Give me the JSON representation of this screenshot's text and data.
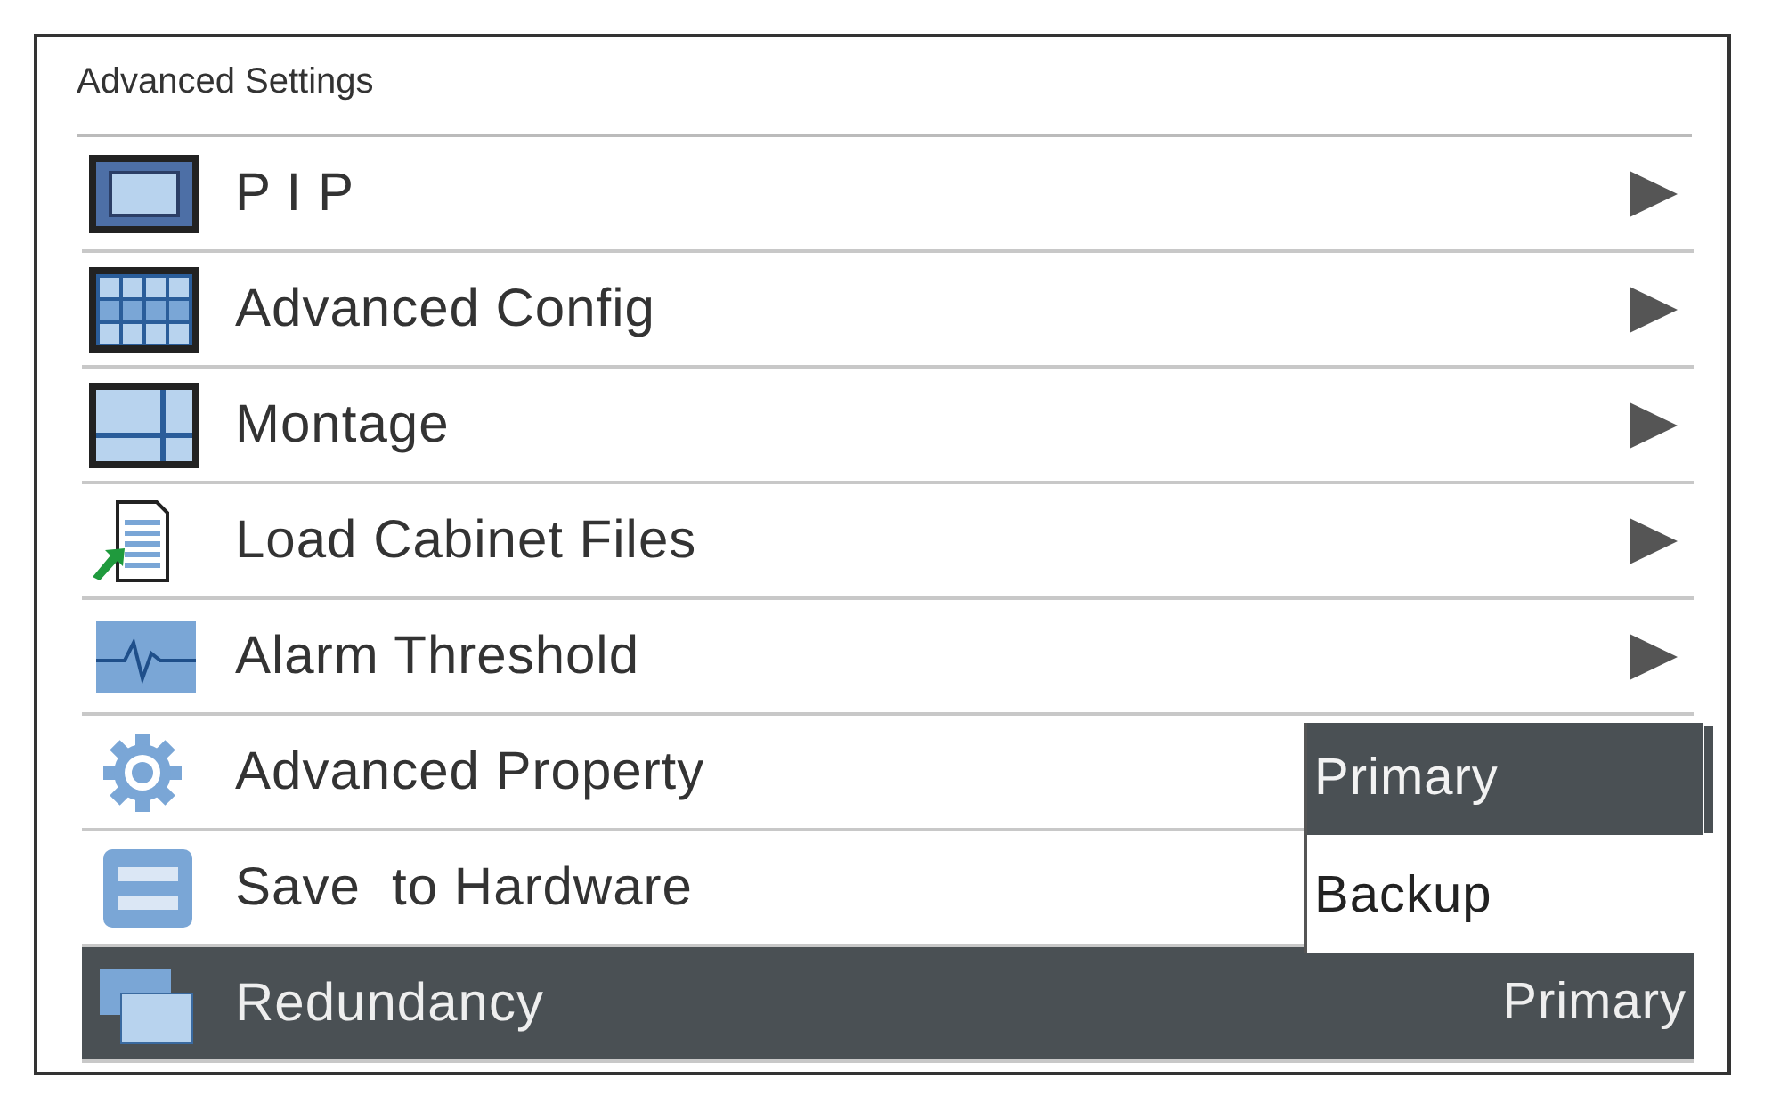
{
  "title": "Advanced Settings",
  "items": [
    {
      "label": "P I P",
      "kind": "window",
      "submenu": true,
      "selected": false
    },
    {
      "label": "Advanced Config",
      "kind": "grid",
      "submenu": true,
      "selected": false
    },
    {
      "label": "Montage",
      "kind": "split",
      "submenu": true,
      "selected": false
    },
    {
      "label": "Load Cabinet Files",
      "kind": "document",
      "submenu": true,
      "selected": false
    },
    {
      "label": "Alarm Threshold",
      "kind": "pulse",
      "submenu": true,
      "selected": false
    },
    {
      "label": "Advanced Property",
      "kind": "gear",
      "submenu": false,
      "selected": false
    },
    {
      "label": "Save  to Hardware",
      "kind": "disk",
      "submenu": false,
      "selected": false
    },
    {
      "label": "Redundancy",
      "kind": "layers",
      "submenu": false,
      "selected": true,
      "value": "Primary"
    }
  ],
  "dropdown": {
    "options": [
      {
        "label": "Primary",
        "selected": true
      },
      {
        "label": "Backup",
        "selected": false
      }
    ]
  }
}
